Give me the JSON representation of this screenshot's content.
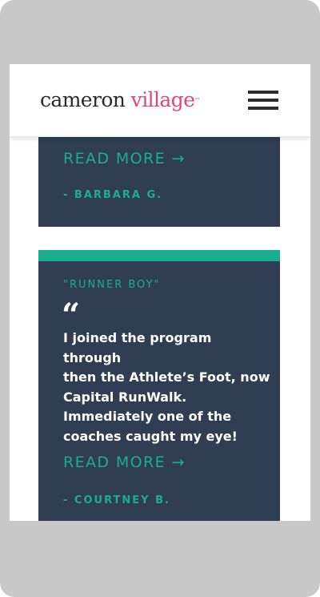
{
  "header": {
    "logo_part1": "cameron",
    "logo_part2": "village",
    "logo_mark": "™",
    "menu_icon": "hamburger-menu-icon"
  },
  "colors": {
    "accent": "#1bae8e",
    "card_bg": "#2f3e52",
    "brand_pink": "#e0457b"
  },
  "testimonials": [
    {
      "read_more": "READ MORE →",
      "author": "- BARBARA G."
    },
    {
      "title": "\"RUNNER BOY\"",
      "quote_mark": "“",
      "quote": "I joined the program through\nthen the Athlete’s Foot, now\nCapital RunWalk.\nImmediately one of the\ncoaches caught my eye!",
      "read_more": "READ MORE →",
      "author": "- COURTNEY B."
    }
  ]
}
